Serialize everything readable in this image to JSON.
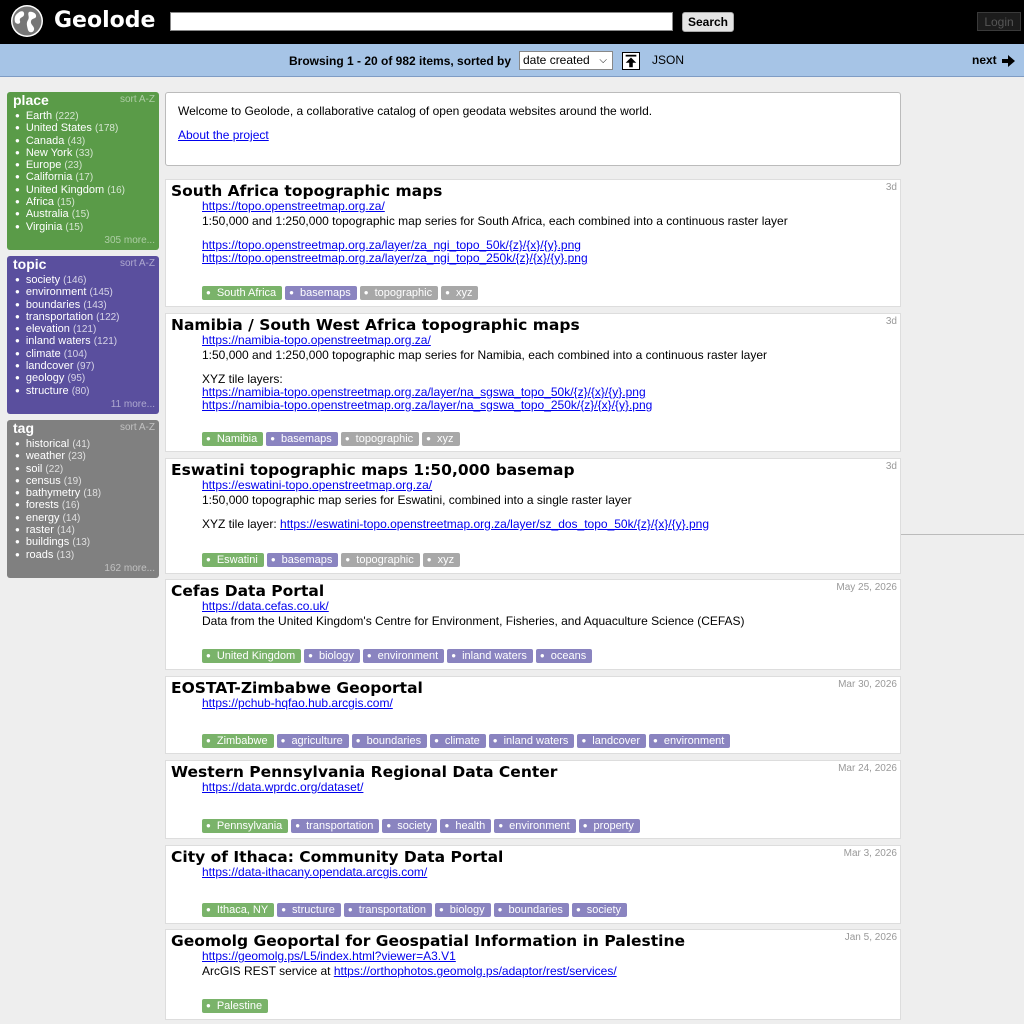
{
  "header": {
    "brand": "Geolode",
    "search_placeholder": "",
    "search_label": "Search",
    "login_label": "Login"
  },
  "browse": {
    "text": "Browsing 1 - 20 of 982 items, sorted by",
    "sort_value": "date created",
    "json_label": "JSON",
    "next_label": "next"
  },
  "sidebar": {
    "place": {
      "title": "place",
      "sort": "sort A-Z",
      "more": "305 more...",
      "items": [
        {
          "label": "Earth",
          "count": "(222)"
        },
        {
          "label": "United States",
          "count": "(178)"
        },
        {
          "label": "Canada",
          "count": "(43)"
        },
        {
          "label": "New York",
          "count": "(33)"
        },
        {
          "label": "Europe",
          "count": "(23)"
        },
        {
          "label": "California",
          "count": "(17)"
        },
        {
          "label": "United Kingdom",
          "count": "(16)"
        },
        {
          "label": "Africa",
          "count": "(15)"
        },
        {
          "label": "Australia",
          "count": "(15)"
        },
        {
          "label": "Virginia",
          "count": "(15)"
        }
      ]
    },
    "topic": {
      "title": "topic",
      "sort": "sort A-Z",
      "more": "11 more...",
      "items": [
        {
          "label": "society",
          "count": "(146)"
        },
        {
          "label": "environment",
          "count": "(145)"
        },
        {
          "label": "boundaries",
          "count": "(143)"
        },
        {
          "label": "transportation",
          "count": "(122)"
        },
        {
          "label": "elevation",
          "count": "(121)"
        },
        {
          "label": "inland waters",
          "count": "(121)"
        },
        {
          "label": "climate",
          "count": "(104)"
        },
        {
          "label": "landcover",
          "count": "(97)"
        },
        {
          "label": "geology",
          "count": "(95)"
        },
        {
          "label": "structure",
          "count": "(80)"
        }
      ]
    },
    "tag": {
      "title": "tag",
      "sort": "sort A-Z",
      "more": "162 more...",
      "items": [
        {
          "label": "historical",
          "count": "(41)"
        },
        {
          "label": "weather",
          "count": "(23)"
        },
        {
          "label": "soil",
          "count": "(22)"
        },
        {
          "label": "census",
          "count": "(19)"
        },
        {
          "label": "bathymetry",
          "count": "(18)"
        },
        {
          "label": "forests",
          "count": "(16)"
        },
        {
          "label": "energy",
          "count": "(14)"
        },
        {
          "label": "raster",
          "count": "(14)"
        },
        {
          "label": "buildings",
          "count": "(13)"
        },
        {
          "label": "roads",
          "count": "(13)"
        }
      ]
    }
  },
  "welcome": {
    "text": "Welcome to Geolode, a collaborative catalog of open geodata websites around the world.",
    "about_label": "About the project"
  },
  "cards": [
    {
      "title": "South Africa topographic maps",
      "date": "3d",
      "url": "https://topo.openstreetmap.org.za/",
      "desc": "1:50,000 and 1:250,000 topographic map series for South Africa, each combined into a continuous raster layer",
      "link1": "https://topo.openstreetmap.org.za/layer/za_ngi_topo_50k/{z}/{x}/{y}.png",
      "link2": "https://topo.openstreetmap.org.za/layer/za_ngi_topo_250k/{z}/{x}/{y}.png",
      "tags": [
        "South Africa",
        "basemaps",
        "topographic",
        "xyz"
      ]
    },
    {
      "title": "Namibia / South West Africa topographic maps",
      "date": "3d",
      "url": "https://namibia-topo.openstreetmap.org.za/",
      "desc": "1:50,000 and 1:250,000 topographic map series for Namibia, each combined into a continuous raster layer",
      "xyz_label": "XYZ tile layers:",
      "link1": "https://namibia-topo.openstreetmap.org.za/layer/na_sgswa_topo_50k/{z}/{x}/{y}.png",
      "link2": "https://namibia-topo.openstreetmap.org.za/layer/na_sgswa_topo_250k/{z}/{x}/{y}.png",
      "tags": [
        "Namibia",
        "basemaps",
        "topographic",
        "xyz"
      ]
    },
    {
      "title": "Eswatini topographic maps 1:50,000 basemap",
      "date": "3d",
      "url": "https://eswatini-topo.openstreetmap.org.za/",
      "desc": "1:50,000 topographic map series for Eswatini, combined into a single raster layer",
      "xyz_label": "XYZ tile layer:",
      "link1": "https://eswatini-topo.openstreetmap.org.za/layer/sz_dos_topo_50k/{z}/{x}/{y}.png",
      "tags": [
        "Eswatini",
        "basemaps",
        "topographic",
        "xyz"
      ]
    },
    {
      "title": "Cefas Data Portal",
      "date": "May 25, 2026",
      "url": "https://data.cefas.co.uk/",
      "desc": "Data from the United Kingdom's Centre for Environment, Fisheries, and Aquaculture Science (CEFAS)",
      "tags": [
        "United Kingdom",
        "biology",
        "environment",
        "inland waters",
        "oceans"
      ]
    },
    {
      "title": "EOSTAT-Zimbabwe Geoportal",
      "date": "Mar 30, 2026",
      "url": "https://pchub-hqfao.hub.arcgis.com/",
      "tags": [
        "Zimbabwe",
        "agriculture",
        "boundaries",
        "climate",
        "inland waters",
        "landcover",
        "environment"
      ]
    },
    {
      "title": "Western Pennsylvania Regional Data Center",
      "date": "Mar 24, 2026",
      "url": "https://data.wprdc.org/dataset/",
      "tags": [
        "Pennsylvania",
        "transportation",
        "society",
        "health",
        "environment",
        "property"
      ]
    },
    {
      "title": "City of Ithaca: Community Data Portal",
      "date": "Mar 3, 2026",
      "url": "https://data-ithacany.opendata.arcgis.com/",
      "tags": [
        "Ithaca, NY",
        "structure",
        "transportation",
        "biology",
        "boundaries",
        "society"
      ]
    },
    {
      "title": "Geomolg Geoportal for Geospatial Information in Palestine",
      "date": "Jan 5, 2026",
      "url": "https://geomolg.ps/L5/index.html?viewer=A3.V1",
      "desc_prefix": "ArcGIS REST service at",
      "link1": "https://orthophotos.geomolg.ps/adaptor/rest/services/",
      "tags": [
        "Palestine"
      ]
    }
  ],
  "colors": {
    "place": "#5a9b48",
    "topic": "#5a4f9e",
    "tag": "#808080",
    "browse_bar": "#a6c4e6"
  }
}
